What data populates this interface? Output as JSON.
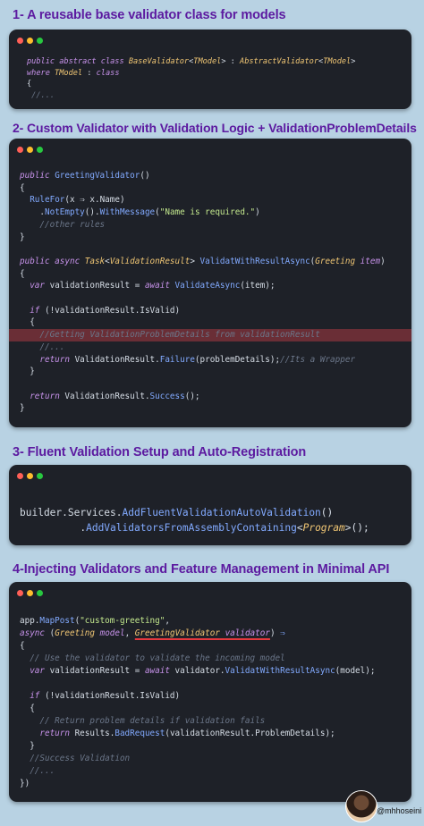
{
  "dot_colors": [
    "#ff5f57",
    "#febc2e",
    "#28c840"
  ],
  "sections": [
    {
      "heading": "1- A reusable base validator class for models",
      "lines": [
        [
          [
            "kw",
            "public abstract class "
          ],
          [
            "ty",
            "BaseValidator"
          ],
          [
            "pl",
            "<"
          ],
          [
            "ty",
            "TModel"
          ],
          [
            "pl",
            "> : "
          ],
          [
            "ty",
            "AbstractValidator"
          ],
          [
            "pl",
            "<"
          ],
          [
            "ty",
            "TModel"
          ],
          [
            "pl",
            ">"
          ]
        ],
        [
          [
            "kw",
            "where "
          ],
          [
            "ty",
            "TModel"
          ],
          [
            "pl",
            " : "
          ],
          [
            "kw",
            "class"
          ]
        ],
        [
          [
            "pl",
            "{"
          ]
        ],
        [
          [
            "cm",
            " //..."
          ]
        ]
      ]
    },
    {
      "heading": "2- Custom Validator with Validation Logic + ValidationProblemDetails",
      "lines": [
        [
          [
            "kw",
            "public "
          ],
          [
            "fn",
            "GreetingValidator"
          ],
          [
            "pl",
            "()"
          ]
        ],
        [
          [
            "pl",
            "{"
          ]
        ],
        [
          [
            "pl",
            "  "
          ],
          [
            "fn",
            "RuleFor"
          ],
          [
            "pl",
            "(x ⇒ x.Name)"
          ]
        ],
        [
          [
            "pl",
            "    ."
          ],
          [
            "fn",
            "NotEmpty"
          ],
          [
            "pl",
            "()."
          ],
          [
            "fn",
            "WithMessage"
          ],
          [
            "pl",
            "("
          ],
          [
            "st",
            "\"Name is required.\""
          ],
          [
            "pl",
            ")"
          ]
        ],
        [
          [
            "cm",
            "    //other rules"
          ]
        ],
        [
          [
            "pl",
            "}"
          ]
        ],
        [
          [
            "pl",
            ""
          ]
        ],
        [
          [
            "kw",
            "public async "
          ],
          [
            "ty",
            "Task"
          ],
          [
            "pl",
            "<"
          ],
          [
            "ty",
            "ValidationResult"
          ],
          [
            "pl",
            "> "
          ],
          [
            "fn",
            "ValidatWithResultAsync"
          ],
          [
            "pl",
            "("
          ],
          [
            "ty",
            "Greeting"
          ],
          [
            "pl",
            " "
          ],
          [
            "kw",
            "item"
          ],
          [
            "pl",
            ")"
          ]
        ],
        [
          [
            "pl",
            "{"
          ]
        ],
        [
          [
            "pl",
            "  "
          ],
          [
            "kw",
            "var "
          ],
          [
            "pl",
            "validationResult = "
          ],
          [
            "kw",
            "await "
          ],
          [
            "fn",
            "ValidateAsync"
          ],
          [
            "pl",
            "(item);"
          ]
        ],
        [
          [
            "pl",
            ""
          ]
        ],
        [
          [
            "pl",
            "  "
          ],
          [
            "kw",
            "if "
          ],
          [
            "pl",
            "(!validationResult.IsValid)"
          ]
        ],
        [
          [
            "pl",
            "  {"
          ]
        ],
        [
          [
            "cm",
            "    //Getting ValidationProblemDetails from validationResult"
          ]
        ],
        [
          [
            "cm",
            "    //..."
          ]
        ],
        [
          [
            "pl",
            "    "
          ],
          [
            "kw",
            "return "
          ],
          [
            "pl",
            "ValidationResult."
          ],
          [
            "fn",
            "Failure"
          ],
          [
            "pl",
            "(problemDetails);"
          ],
          [
            "cm",
            "//Its a Wrapper"
          ]
        ],
        [
          [
            "pl",
            "  }"
          ]
        ],
        [
          [
            "pl",
            ""
          ]
        ],
        [
          [
            "pl",
            "  "
          ],
          [
            "kw",
            "return "
          ],
          [
            "pl",
            "ValidationResult."
          ],
          [
            "fn",
            "Success"
          ],
          [
            "pl",
            "();"
          ]
        ],
        [
          [
            "pl",
            "}"
          ]
        ]
      ]
    },
    {
      "heading": "3- Fluent Validation Setup and Auto-Registration",
      "lines": [
        [
          [
            "pl",
            "builder.Services."
          ],
          [
            "fn",
            "AddFluentValidationAutoValidation"
          ],
          [
            "pl",
            "()"
          ]
        ],
        [
          [
            "pl",
            "          ."
          ],
          [
            "fn",
            "AddValidatorsFromAssemblyContaining"
          ],
          [
            "pl",
            "<"
          ],
          [
            "ty",
            "Program"
          ],
          [
            "pl",
            ">();"
          ]
        ]
      ]
    },
    {
      "heading": "4-Injecting Validators and Feature Management in Minimal API",
      "lines": [
        [
          [
            "pl",
            "app."
          ],
          [
            "fn",
            "MapPost"
          ],
          [
            "pl",
            "("
          ],
          [
            "st",
            "\"custom-greeting\""
          ],
          [
            "pl",
            ","
          ]
        ],
        [
          [
            "kw",
            "async "
          ],
          [
            "pl",
            "("
          ],
          [
            "ty",
            "Greeting"
          ],
          [
            "pl",
            " "
          ],
          [
            "kw",
            "model"
          ],
          [
            "pl",
            ", "
          ],
          [
            "ty",
            "GreetingValidator"
          ],
          [
            "pl",
            " "
          ],
          [
            "kw",
            "validator"
          ],
          [
            "pl",
            ") "
          ],
          [
            "fn",
            "⇒"
          ]
        ],
        [
          [
            "pl",
            "{"
          ]
        ],
        [
          [
            "cm",
            "  // Use the validator to validate the incoming model"
          ]
        ],
        [
          [
            "pl",
            "  "
          ],
          [
            "kw",
            "var "
          ],
          [
            "pl",
            "validationResult = "
          ],
          [
            "kw",
            "await "
          ],
          [
            "pl",
            "validator."
          ],
          [
            "fn",
            "ValidatWithResultAsync"
          ],
          [
            "pl",
            "(model);"
          ]
        ],
        [
          [
            "pl",
            ""
          ]
        ],
        [
          [
            "pl",
            "  "
          ],
          [
            "kw",
            "if "
          ],
          [
            "pl",
            "(!validationResult.IsValid)"
          ]
        ],
        [
          [
            "pl",
            "  {"
          ]
        ],
        [
          [
            "cm",
            "    // Return problem details if validation fails"
          ]
        ],
        [
          [
            "pl",
            "    "
          ],
          [
            "kw",
            "return "
          ],
          [
            "pl",
            "Results."
          ],
          [
            "fn",
            "BadRequest"
          ],
          [
            "pl",
            "(validationResult.ProblemDetails);"
          ]
        ],
        [
          [
            "pl",
            "  }"
          ]
        ],
        [
          [
            "cm",
            "  //Success Validation"
          ]
        ],
        [
          [
            "cm",
            "  //..."
          ]
        ],
        [
          [
            "pl",
            "})"
          ]
        ]
      ]
    }
  ],
  "author_handle": "@mhhoseini"
}
